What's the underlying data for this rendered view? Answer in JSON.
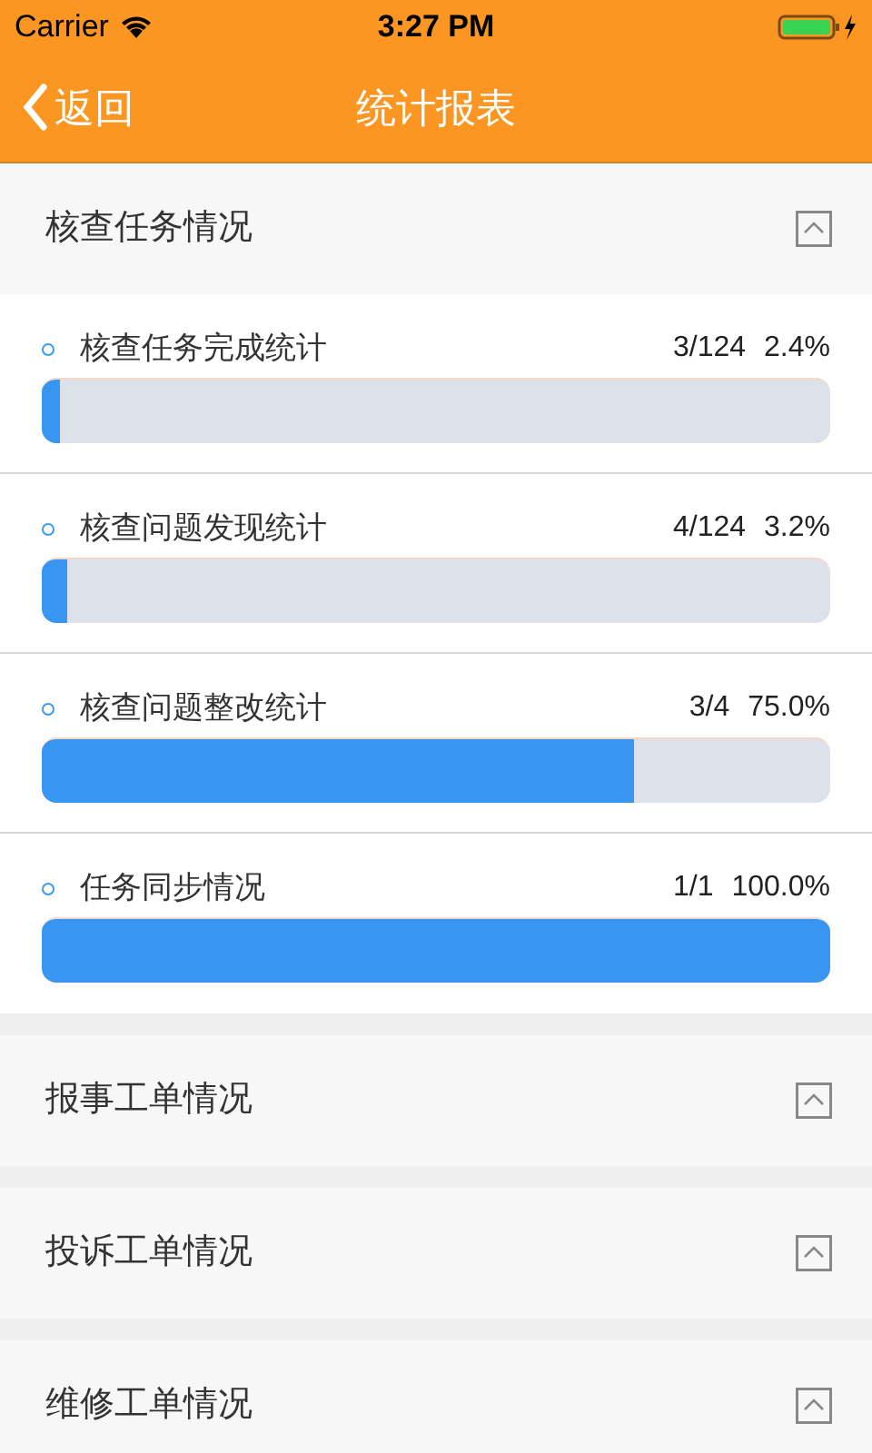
{
  "status_bar": {
    "carrier": "Carrier",
    "time": "3:27 PM"
  },
  "nav": {
    "back": "返回",
    "title": "统计报表"
  },
  "sections": [
    {
      "title": "核查任务情况",
      "items": [
        {
          "name": "核查任务完成统计",
          "count": "3/124",
          "percent": "2.4%",
          "level": 0.024
        },
        {
          "name": "核查问题发现统计",
          "count": "4/124",
          "percent": "3.2%",
          "level": 0.032
        },
        {
          "name": "核查问题整改统计",
          "count": "3/4",
          "percent": "75.0%",
          "level": 0.75
        },
        {
          "name": "任务同步情况",
          "count": "1/1",
          "percent": "100.0%",
          "level": 1
        }
      ]
    },
    {
      "title": "报事工单情况"
    },
    {
      "title": "投诉工单情况"
    },
    {
      "title": "维修工单情况"
    }
  ]
}
